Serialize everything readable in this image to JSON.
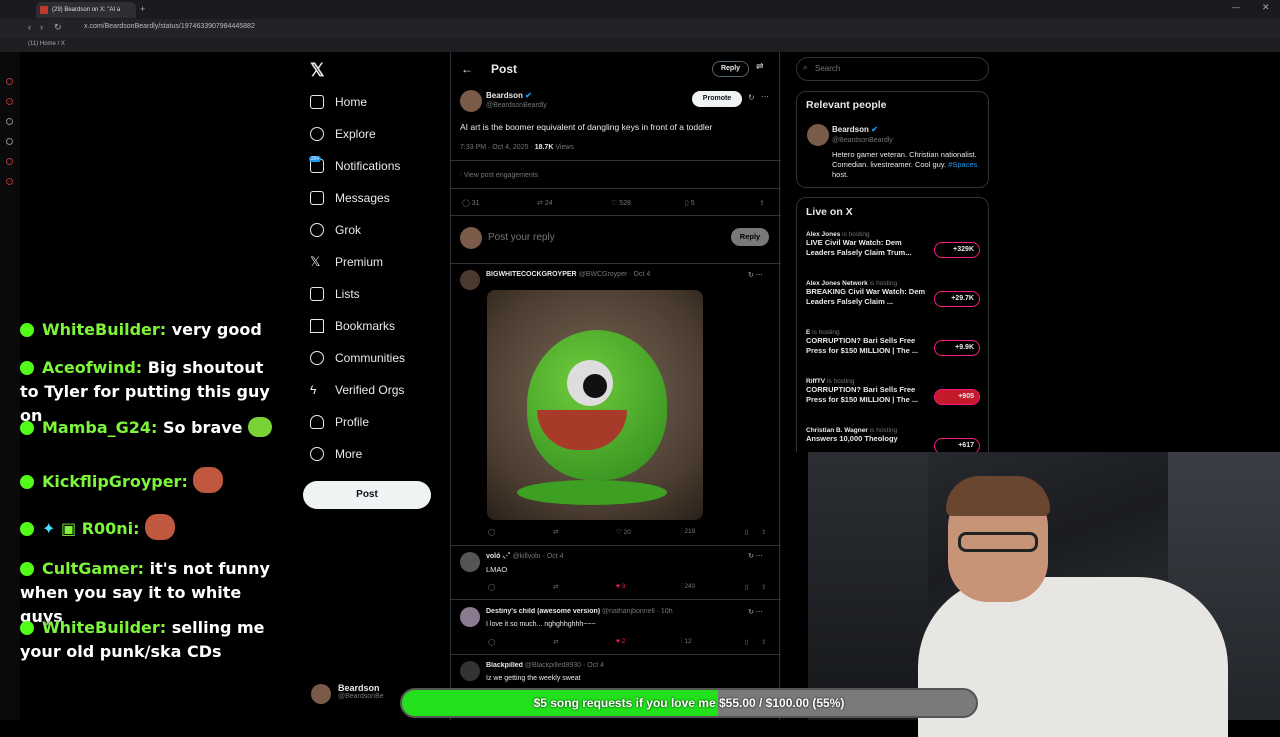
{
  "browser": {
    "tab_title": "(29) Beardson on X: \"AI a",
    "url": "x.com/BeardsonBeardly/status/1974633907984445882",
    "bookmark": "(11) Home / X"
  },
  "chat": [
    {
      "user": "WhiteBuilder:",
      "msg": "very good"
    },
    {
      "user": "Aceofwind:",
      "msg": "Big shoutout to Tyler for putting this guy on"
    },
    {
      "user": "Mamba_G24:",
      "msg": "So brave"
    },
    {
      "user": "KickflipGroyper:",
      "msg": ""
    },
    {
      "user": "R00ni:",
      "msg": ""
    },
    {
      "user": "CultGamer:",
      "msg": "it's not funny when you say it to white guys"
    },
    {
      "user": "WhiteBuilder:",
      "msg": "selling me your old punk/ska CDs"
    }
  ],
  "sidebar": {
    "items": [
      {
        "label": "Home",
        "icon": "home-icon"
      },
      {
        "label": "Explore",
        "icon": "search-icon"
      },
      {
        "label": "Notifications",
        "icon": "bell-icon",
        "badge": "20+"
      },
      {
        "label": "Messages",
        "icon": "mail-icon"
      },
      {
        "label": "Grok",
        "icon": "grok-icon"
      },
      {
        "label": "Premium",
        "icon": "x-logo-icon"
      },
      {
        "label": "Lists",
        "icon": "list-icon"
      },
      {
        "label": "Bookmarks",
        "icon": "bookmark-icon"
      },
      {
        "label": "Communities",
        "icon": "people-icon"
      },
      {
        "label": "Verified Orgs",
        "icon": "bolt-icon"
      },
      {
        "label": "Profile",
        "icon": "person-icon"
      },
      {
        "label": "More",
        "icon": "more-icon"
      }
    ],
    "post_label": "Post",
    "account_name": "Beardson",
    "account_handle": "@BeardsonBe"
  },
  "main": {
    "header_title": "Post",
    "reply_label": "Reply",
    "author_name": "Beardson",
    "author_handle": "@BeardsonBeardly",
    "promote_label": "Promote",
    "tweet_text": "AI art is the boomer equivalent of dangling keys in front of a toddler",
    "timestamp": "7:33 PM · Oct 4, 2025 · ",
    "views": "18.7K",
    "views_label": "Views",
    "engagements_label": "View post engagements",
    "replies": "31",
    "reposts": "24",
    "likes": "528",
    "bookmarks": "5",
    "reply_placeholder": "Post your reply",
    "reply_button": "Reply",
    "replies_list": [
      {
        "name": "BIGWHITECOCKGROYPER",
        "handle": "@BWCGroyper · Oct 4",
        "text": "",
        "likes": "20",
        "views": "219"
      },
      {
        "name": "voló ⸜·˚",
        "handle": "@killvolo · Oct 4",
        "text": "LMAO",
        "likes": "3",
        "views": "240"
      },
      {
        "name": "Destiny's child (awesome version)",
        "handle": "@nathanjbonnell · 10h",
        "text": "I love it so much... nghghhghhh~~~",
        "likes": "2",
        "views": "12"
      },
      {
        "name": "Blackpilled",
        "handle": "@Blackpilled8930 · Oct 4",
        "text": "Iz we getting the weekly sweat",
        "likes": "",
        "views": ""
      }
    ]
  },
  "right": {
    "search_placeholder": "Search",
    "relevant_title": "Relevant people",
    "rp_name": "Beardson",
    "rp_handle": "@BeardsonBeardly",
    "rp_bio": "Hetero gamer veteran. Christian nationalist. Comedian. livestreamer. Cool guy. ",
    "rp_bio_tag": "#Spaces",
    "rp_bio_end": " host.",
    "live_title": "Live on X",
    "live": [
      {
        "host": "Alex Jones",
        "status": "is hosting",
        "title": "LIVE Civil War Watch: Dem Leaders Falsely Claim Trum...",
        "count": "+329K"
      },
      {
        "host": "Alex Jones Network",
        "status": "is hosting",
        "title": "BREAKING Civil War Watch: Dem Leaders Falsely Claim ...",
        "count": "+29.7K"
      },
      {
        "host": "E",
        "status": "is hosting",
        "title": "CORRUPTION? Bari Sells Free Press for $150 MILLION | The ...",
        "count": "+9.9K"
      },
      {
        "host": "RiffTV",
        "status": "is hosting",
        "title": "CORRUPTION? Bari Sells Free Press for $150 MILLION | The ...",
        "count": "+905"
      },
      {
        "host": "Christian B. Wagner",
        "status": "is hosting",
        "title": "Answers 10,000 Theology",
        "count": "+617"
      }
    ]
  },
  "donation": {
    "text": "$5 song requests if you love me $55.00 / $100.00 (55%)",
    "progress": 0.55
  },
  "colors": {
    "accent": "#1d9bf0",
    "like": "#f91880",
    "kick_green": "#53fc18",
    "donate_green": "#22e01c"
  }
}
